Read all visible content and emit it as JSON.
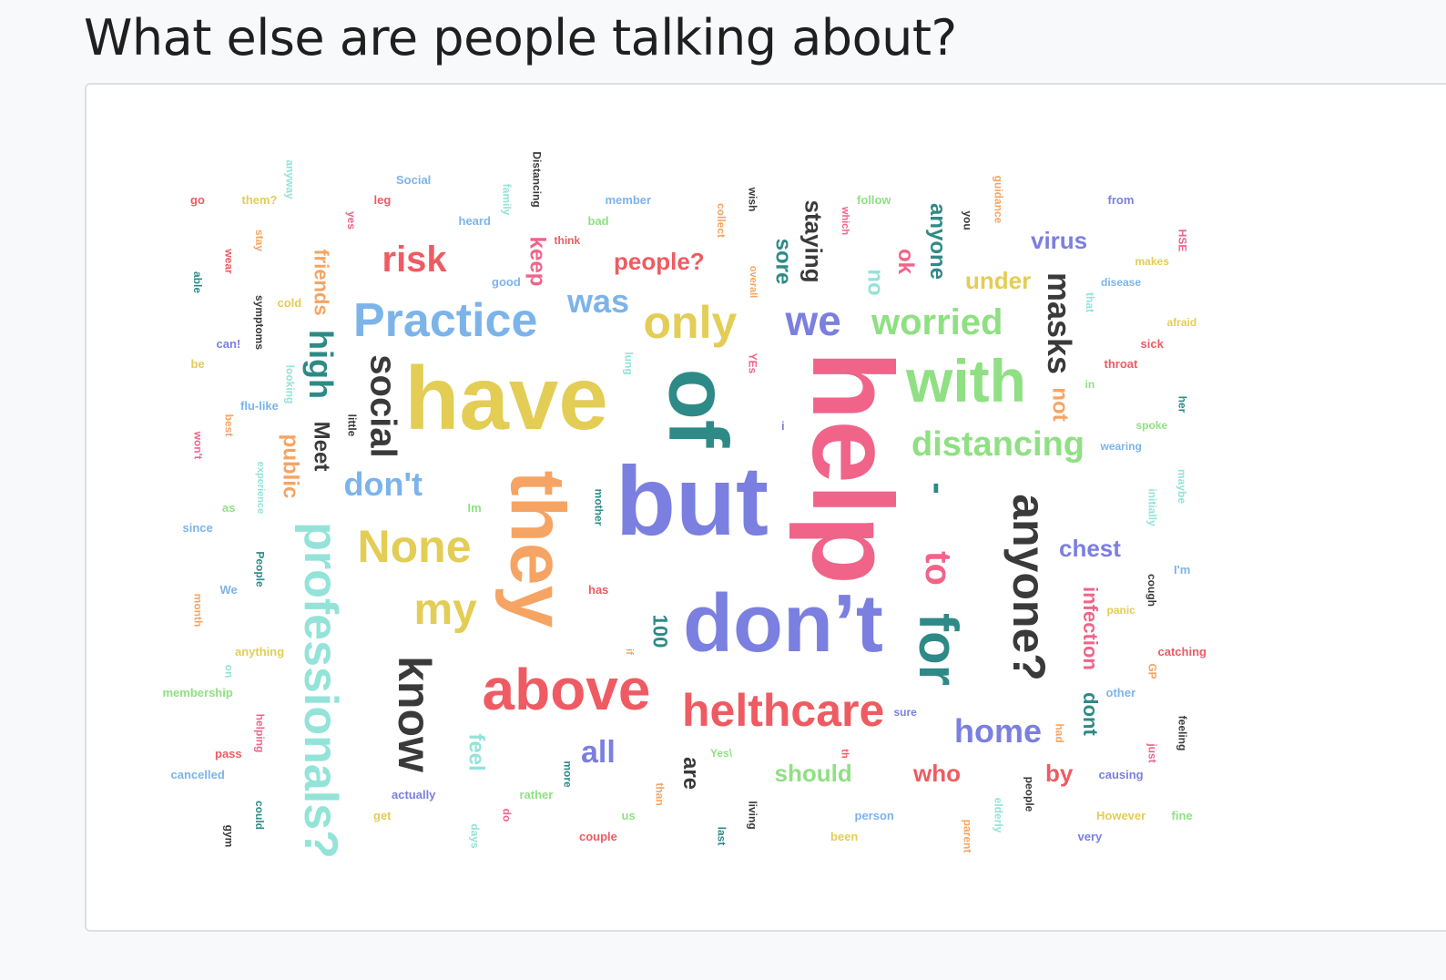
{
  "header": {
    "title": "What else are people talking about?"
  },
  "colors": {
    "red": "#ef5b62",
    "pink": "#f0648a",
    "orange": "#f6a463",
    "yellow": "#e3cd55",
    "green": "#8fe083",
    "teal": "#2e8a87",
    "cyan": "#93e3d8",
    "blue": "#7cb4ea",
    "purple": "#7b7fe0",
    "dark": "#3a3a3a"
  },
  "word_cloud": {
    "words": [
      {
        "text": "help",
        "color": "pink",
        "weight": 125,
        "rotated": true
      },
      {
        "text": "but",
        "color": "purple",
        "weight": 108,
        "rotated": false
      },
      {
        "text": "have",
        "color": "yellow",
        "weight": 98,
        "rotated": false
      },
      {
        "text": "of",
        "color": "teal",
        "weight": 92,
        "rotated": true
      },
      {
        "text": "they",
        "color": "orange",
        "weight": 84,
        "rotated": true
      },
      {
        "text": "don’t",
        "color": "purple",
        "weight": 90,
        "rotated": false
      },
      {
        "text": "with",
        "color": "green",
        "weight": 66,
        "rotated": false
      },
      {
        "text": "above",
        "color": "red",
        "weight": 64,
        "rotated": false
      },
      {
        "text": "for",
        "color": "teal",
        "weight": 60,
        "rotated": true
      },
      {
        "text": "professionals?",
        "color": "cyan",
        "weight": 52,
        "rotated": true
      },
      {
        "text": "anyone?",
        "color": "dark",
        "weight": 50,
        "rotated": true
      },
      {
        "text": "know",
        "color": "dark",
        "weight": 50,
        "rotated": true
      },
      {
        "text": "Practice",
        "color": "blue",
        "weight": 52,
        "rotated": false
      },
      {
        "text": "None",
        "color": "yellow",
        "weight": 50,
        "rotated": false
      },
      {
        "text": "helthcare",
        "color": "red",
        "weight": 50,
        "rotated": false
      },
      {
        "text": "only",
        "color": "yellow",
        "weight": 50,
        "rotated": false
      },
      {
        "text": "my",
        "color": "yellow",
        "weight": 48,
        "rotated": false
      },
      {
        "text": "social",
        "color": "dark",
        "weight": 40,
        "rotated": true
      },
      {
        "text": "risk",
        "color": "red",
        "weight": 40,
        "rotated": false
      },
      {
        "text": "we",
        "color": "purple",
        "weight": 46,
        "rotated": false
      },
      {
        "text": "worried",
        "color": "green",
        "weight": 40,
        "rotated": false
      },
      {
        "text": "distancing",
        "color": "green",
        "weight": 38,
        "rotated": false
      },
      {
        "text": "masks",
        "color": "dark",
        "weight": 36,
        "rotated": true
      },
      {
        "text": "to",
        "color": "pink",
        "weight": 40,
        "rotated": true
      },
      {
        "text": "high",
        "color": "teal",
        "weight": 36,
        "rotated": true
      },
      {
        "text": "don't",
        "color": "blue",
        "weight": 36,
        "rotated": false
      },
      {
        "text": "was",
        "color": "blue",
        "weight": 36,
        "rotated": false
      },
      {
        "text": "home",
        "color": "purple",
        "weight": 36,
        "rotated": false
      },
      {
        "text": "all",
        "color": "purple",
        "weight": 34,
        "rotated": false
      },
      {
        "text": "-",
        "color": "teal",
        "weight": 40,
        "rotated": true
      },
      {
        "text": "infection",
        "color": "pink",
        "weight": 22,
        "rotated": true
      },
      {
        "text": "dont",
        "color": "teal",
        "weight": 22,
        "rotated": true
      },
      {
        "text": "people?",
        "color": "red",
        "weight": 26,
        "rotated": false
      },
      {
        "text": "chest",
        "color": "purple",
        "weight": 26,
        "rotated": false
      },
      {
        "text": "virus",
        "color": "purple",
        "weight": 26,
        "rotated": false
      },
      {
        "text": "under",
        "color": "yellow",
        "weight": 26,
        "rotated": false
      },
      {
        "text": "staying",
        "color": "dark",
        "weight": 26,
        "rotated": true
      },
      {
        "text": "anyone",
        "color": "teal",
        "weight": 24,
        "rotated": true
      },
      {
        "text": "should",
        "color": "green",
        "weight": 26,
        "rotated": false
      },
      {
        "text": "who",
        "color": "red",
        "weight": 26,
        "rotated": false
      },
      {
        "text": "by",
        "color": "red",
        "weight": 26,
        "rotated": false
      },
      {
        "text": "public",
        "color": "orange",
        "weight": 24,
        "rotated": true
      },
      {
        "text": "Meet",
        "color": "dark",
        "weight": 24,
        "rotated": true
      },
      {
        "text": "friends",
        "color": "orange",
        "weight": 22,
        "rotated": true
      },
      {
        "text": "sore",
        "color": "teal",
        "weight": 24,
        "rotated": true
      },
      {
        "text": "keep",
        "color": "pink",
        "weight": 24,
        "rotated": true
      },
      {
        "text": "not",
        "color": "orange",
        "weight": 24,
        "rotated": true
      },
      {
        "text": "no",
        "color": "cyan",
        "weight": 24,
        "rotated": true
      },
      {
        "text": "ok",
        "color": "pink",
        "weight": 24,
        "rotated": true
      },
      {
        "text": "feel",
        "color": "cyan",
        "weight": 24,
        "rotated": true
      },
      {
        "text": "are",
        "color": "dark",
        "weight": 24,
        "rotated": true
      },
      {
        "text": "100",
        "color": "teal",
        "weight": 22,
        "rotated": true
      },
      {
        "text": "Social",
        "color": "blue",
        "weight": 13,
        "rotated": false
      },
      {
        "text": "go",
        "color": "red",
        "weight": 13,
        "rotated": false
      },
      {
        "text": "them?",
        "color": "yellow",
        "weight": 13,
        "rotated": false
      },
      {
        "text": "leg",
        "color": "red",
        "weight": 13,
        "rotated": false
      },
      {
        "text": "member",
        "color": "blue",
        "weight": 13,
        "rotated": false
      },
      {
        "text": "heard",
        "color": "blue",
        "weight": 13,
        "rotated": false
      },
      {
        "text": "bad",
        "color": "green",
        "weight": 13,
        "rotated": false
      },
      {
        "text": "think",
        "color": "red",
        "weight": 12,
        "rotated": false
      },
      {
        "text": "good",
        "color": "blue",
        "weight": 13,
        "rotated": false
      },
      {
        "text": "follow",
        "color": "green",
        "weight": 13,
        "rotated": false
      },
      {
        "text": "from",
        "color": "purple",
        "weight": 13,
        "rotated": false
      },
      {
        "text": "makes",
        "color": "yellow",
        "weight": 12,
        "rotated": false
      },
      {
        "text": "disease",
        "color": "blue",
        "weight": 12,
        "rotated": false
      },
      {
        "text": "afraid",
        "color": "yellow",
        "weight": 12,
        "rotated": false
      },
      {
        "text": "sick",
        "color": "red",
        "weight": 13,
        "rotated": false
      },
      {
        "text": "throat",
        "color": "red",
        "weight": 13,
        "rotated": false
      },
      {
        "text": "in",
        "color": "green",
        "weight": 12,
        "rotated": false
      },
      {
        "text": "spoke",
        "color": "green",
        "weight": 12,
        "rotated": false
      },
      {
        "text": "wearing",
        "color": "blue",
        "weight": 12,
        "rotated": false
      },
      {
        "text": "I'm",
        "color": "blue",
        "weight": 13,
        "rotated": false
      },
      {
        "text": "panic",
        "color": "yellow",
        "weight": 12,
        "rotated": false
      },
      {
        "text": "catching",
        "color": "red",
        "weight": 13,
        "rotated": false
      },
      {
        "text": "other",
        "color": "blue",
        "weight": 13,
        "rotated": false
      },
      {
        "text": "causing",
        "color": "purple",
        "weight": 13,
        "rotated": false
      },
      {
        "text": "However",
        "color": "yellow",
        "weight": 13,
        "rotated": false
      },
      {
        "text": "fine",
        "color": "green",
        "weight": 13,
        "rotated": false
      },
      {
        "text": "very",
        "color": "purple",
        "weight": 13,
        "rotated": false
      },
      {
        "text": "sure",
        "color": "purple",
        "weight": 12,
        "rotated": false
      },
      {
        "text": "person",
        "color": "blue",
        "weight": 13,
        "rotated": false
      },
      {
        "text": "been",
        "color": "yellow",
        "weight": 13,
        "rotated": false
      },
      {
        "text": "us",
        "color": "green",
        "weight": 13,
        "rotated": false
      },
      {
        "text": "couple",
        "color": "red",
        "weight": 13,
        "rotated": false
      },
      {
        "text": "rather",
        "color": "green",
        "weight": 13,
        "rotated": false
      },
      {
        "text": "get",
        "color": "yellow",
        "weight": 13,
        "rotated": false
      },
      {
        "text": "actually",
        "color": "purple",
        "weight": 13,
        "rotated": false
      },
      {
        "text": "has",
        "color": "red",
        "weight": 13,
        "rotated": false
      },
      {
        "text": "Yes\\",
        "color": "green",
        "weight": 12,
        "rotated": false
      },
      {
        "text": "Im",
        "color": "green",
        "weight": 13,
        "rotated": false
      },
      {
        "text": "i",
        "color": "purple",
        "weight": 13,
        "rotated": false
      },
      {
        "text": "can!",
        "color": "purple",
        "weight": 13,
        "rotated": false
      },
      {
        "text": "cold",
        "color": "yellow",
        "weight": 13,
        "rotated": false
      },
      {
        "text": "be",
        "color": "yellow",
        "weight": 13,
        "rotated": false
      },
      {
        "text": "flu-like",
        "color": "blue",
        "weight": 13,
        "rotated": false
      },
      {
        "text": "as",
        "color": "green",
        "weight": 13,
        "rotated": false
      },
      {
        "text": "since",
        "color": "blue",
        "weight": 13,
        "rotated": false
      },
      {
        "text": "We",
        "color": "blue",
        "weight": 13,
        "rotated": false
      },
      {
        "text": "anything",
        "color": "yellow",
        "weight": 13,
        "rotated": false
      },
      {
        "text": "membership",
        "color": "green",
        "weight": 13,
        "rotated": false
      },
      {
        "text": "pass",
        "color": "red",
        "weight": 13,
        "rotated": false
      },
      {
        "text": "cancelled",
        "color": "blue",
        "weight": 13,
        "rotated": false
      },
      {
        "text": "anyway",
        "color": "cyan",
        "weight": 12,
        "rotated": true
      },
      {
        "text": "yes",
        "color": "pink",
        "weight": 12,
        "rotated": true
      },
      {
        "text": "family",
        "color": "cyan",
        "weight": 12,
        "rotated": true
      },
      {
        "text": "Distancing",
        "color": "dark",
        "weight": 12,
        "rotated": true
      },
      {
        "text": "collect",
        "color": "orange",
        "weight": 12,
        "rotated": true
      },
      {
        "text": "wish",
        "color": "dark",
        "weight": 12,
        "rotated": true
      },
      {
        "text": "which",
        "color": "pink",
        "weight": 11,
        "rotated": true
      },
      {
        "text": "you",
        "color": "dark",
        "weight": 12,
        "rotated": true
      },
      {
        "text": "guidance",
        "color": "orange",
        "weight": 12,
        "rotated": true
      },
      {
        "text": "HSE",
        "color": "pink",
        "weight": 12,
        "rotated": true
      },
      {
        "text": "wear",
        "color": "red",
        "weight": 12,
        "rotated": true
      },
      {
        "text": "stay",
        "color": "orange",
        "weight": 12,
        "rotated": true
      },
      {
        "text": "able",
        "color": "teal",
        "weight": 12,
        "rotated": true
      },
      {
        "text": "symptoms",
        "color": "dark",
        "weight": 12,
        "rotated": true
      },
      {
        "text": "overall",
        "color": "orange",
        "weight": 11,
        "rotated": true
      },
      {
        "text": "that",
        "color": "cyan",
        "weight": 12,
        "rotated": true
      },
      {
        "text": "looking",
        "color": "cyan",
        "weight": 12,
        "rotated": true
      },
      {
        "text": "lung",
        "color": "cyan",
        "weight": 12,
        "rotated": true
      },
      {
        "text": "YEs",
        "color": "pink",
        "weight": 12,
        "rotated": true
      },
      {
        "text": "her",
        "color": "teal",
        "weight": 12,
        "rotated": true
      },
      {
        "text": "best",
        "color": "orange",
        "weight": 12,
        "rotated": true
      },
      {
        "text": "little",
        "color": "dark",
        "weight": 12,
        "rotated": true
      },
      {
        "text": "won't",
        "color": "pink",
        "weight": 12,
        "rotated": true
      },
      {
        "text": "experience",
        "color": "cyan",
        "weight": 11,
        "rotated": true
      },
      {
        "text": "mother",
        "color": "teal",
        "weight": 12,
        "rotated": true
      },
      {
        "text": "initially",
        "color": "cyan",
        "weight": 12,
        "rotated": true
      },
      {
        "text": "maybe",
        "color": "cyan",
        "weight": 12,
        "rotated": true
      },
      {
        "text": "People",
        "color": "teal",
        "weight": 12,
        "rotated": true
      },
      {
        "text": "cough",
        "color": "dark",
        "weight": 12,
        "rotated": true
      },
      {
        "text": "month",
        "color": "orange",
        "weight": 12,
        "rotated": true
      },
      {
        "text": "if",
        "color": "orange",
        "weight": 11,
        "rotated": true
      },
      {
        "text": "on",
        "color": "cyan",
        "weight": 12,
        "rotated": true
      },
      {
        "text": "GP",
        "color": "orange",
        "weight": 12,
        "rotated": true
      },
      {
        "text": "helping",
        "color": "pink",
        "weight": 12,
        "rotated": true
      },
      {
        "text": "had",
        "color": "orange",
        "weight": 12,
        "rotated": true
      },
      {
        "text": "feeling",
        "color": "dark",
        "weight": 12,
        "rotated": true
      },
      {
        "text": "just",
        "color": "pink",
        "weight": 12,
        "rotated": true
      },
      {
        "text": "more",
        "color": "teal",
        "weight": 12,
        "rotated": true
      },
      {
        "text": "th",
        "color": "red",
        "weight": 11,
        "rotated": true
      },
      {
        "text": "than",
        "color": "orange",
        "weight": 12,
        "rotated": true
      },
      {
        "text": "people",
        "color": "dark",
        "weight": 12,
        "rotated": true
      },
      {
        "text": "gym",
        "color": "dark",
        "weight": 12,
        "rotated": true
      },
      {
        "text": "could",
        "color": "teal",
        "weight": 12,
        "rotated": true
      },
      {
        "text": "days",
        "color": "cyan",
        "weight": 12,
        "rotated": true
      },
      {
        "text": "do",
        "color": "pink",
        "weight": 12,
        "rotated": true
      },
      {
        "text": "last",
        "color": "teal",
        "weight": 12,
        "rotated": true
      },
      {
        "text": "living",
        "color": "dark",
        "weight": 12,
        "rotated": true
      },
      {
        "text": "elderly",
        "color": "cyan",
        "weight": 12,
        "rotated": true
      },
      {
        "text": "parent",
        "color": "orange",
        "weight": 12,
        "rotated": true
      }
    ]
  }
}
